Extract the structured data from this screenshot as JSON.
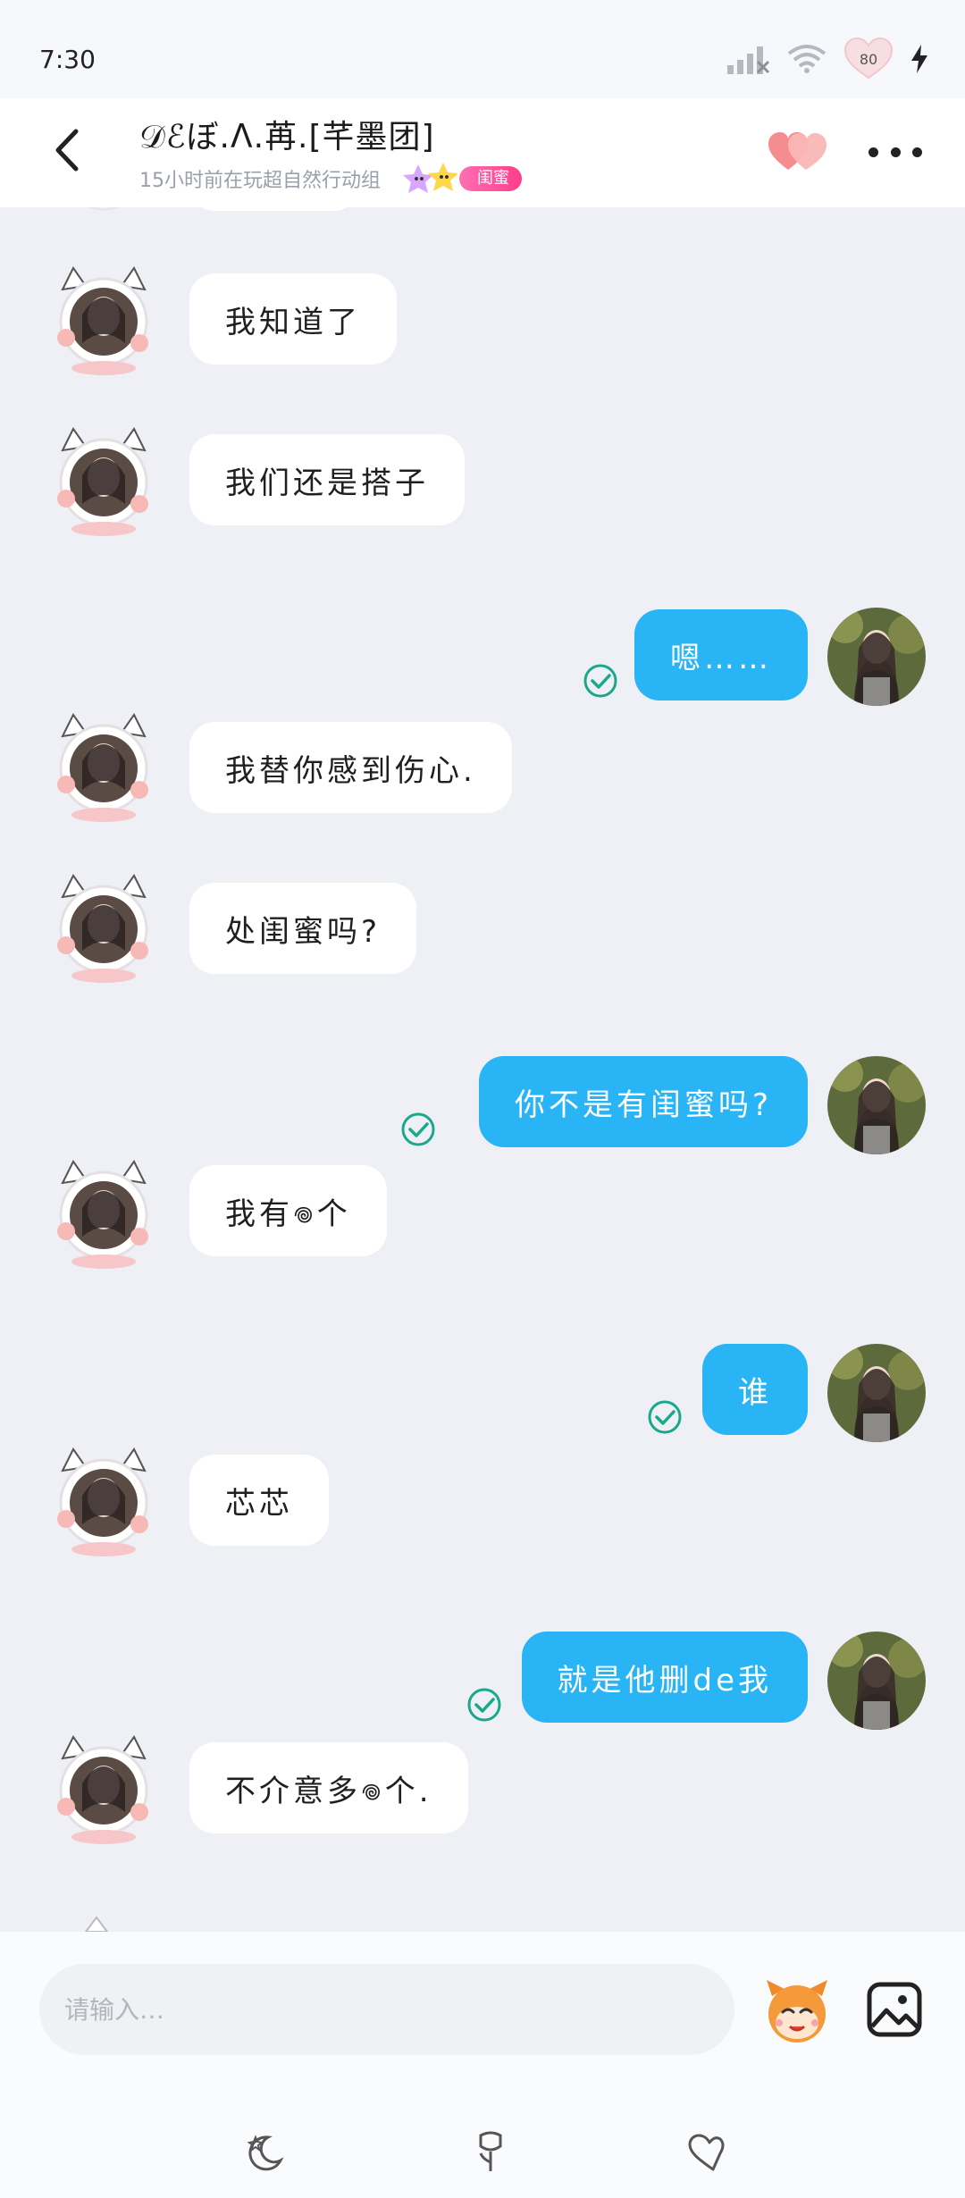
{
  "status": {
    "time": "7:30",
    "battery": "80"
  },
  "header": {
    "title": "𝒟ℰぼ.ᐱ.苒.[芊墨团]",
    "subtitle": "15小时前在玩超自然行动组",
    "badge": "闺蜜"
  },
  "messages": [
    {
      "side": "in",
      "text": "我知道了"
    },
    {
      "side": "in",
      "text": "我们还是搭子"
    },
    {
      "side": "out",
      "text": "嗯……"
    },
    {
      "side": "in",
      "text": "我替你感到伤心."
    },
    {
      "side": "in",
      "text": "处闺蜜吗?"
    },
    {
      "side": "out",
      "text": "你不是有闺蜜吗?"
    },
    {
      "side": "in",
      "text": "我有𖦹个"
    },
    {
      "side": "out",
      "text": "谁"
    },
    {
      "side": "in",
      "text": "芯芯"
    },
    {
      "side": "out",
      "text": "就是他删de我"
    },
    {
      "side": "in",
      "text": "不介意多𖦹个."
    }
  ],
  "input": {
    "placeholder": "请输入…"
  },
  "icons": {
    "back": "chevron-left-icon",
    "hearts": "hearts-icon",
    "more": "more-dots-icon",
    "emoji": "emoji-mascot-icon",
    "image": "image-icon",
    "bottom": [
      "moon-star-icon",
      "rose-icon",
      "heart-outline-icon"
    ]
  },
  "colors": {
    "outgoing_bubble": "#29b4f6",
    "incoming_bubble": "#ffffff",
    "check": "#1aa88a",
    "badge": "#ff3d8a"
  }
}
